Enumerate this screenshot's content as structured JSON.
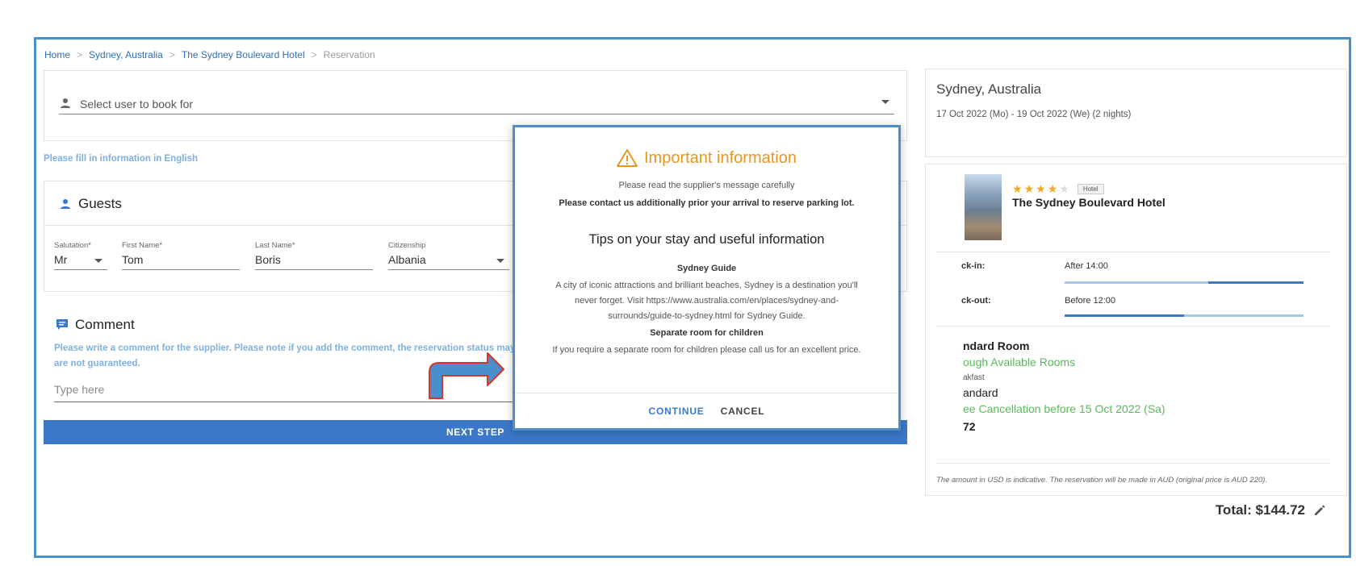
{
  "breadcrumb": [
    {
      "label": "Home"
    },
    {
      "label": "Sydney, Australia"
    },
    {
      "label": "The Sydney Boulevard Hotel"
    },
    {
      "label": "Reservation"
    }
  ],
  "breadcrumb_separator": ">",
  "user_select": {
    "placeholder": "Select user to book for"
  },
  "fill_note": "Please fill in information in English",
  "guests": {
    "title": "Guests",
    "fields": {
      "salutation": {
        "label": "Salutation*",
        "value": "Mr"
      },
      "first_name": {
        "label": "First Name*",
        "value": "Tom"
      },
      "last_name": {
        "label": "Last Name*",
        "value": "Boris"
      },
      "citizenship": {
        "label": "Citizenship",
        "value": "Albania"
      }
    }
  },
  "comment": {
    "title": "Comment",
    "note": "Please write a comment for the supplier. Please note if you add the comment, the reservation status may be cha",
    "note_line2": "are not guaranteed.",
    "placeholder": "Type here"
  },
  "next_step_label": "NEXT STEP",
  "summary": {
    "city": "Sydney, Australia",
    "dates": "17 Oct 2022 (Mo) - 19 Oct 2022 (We) (2 nights)"
  },
  "hotel": {
    "rating": 4,
    "max_rating": 5,
    "badge": "Hotel",
    "name": "The Sydney Boulevard Hotel",
    "checkin_label": "ck-in:",
    "checkin_value": "After 14:00",
    "checkin_level": 0.6,
    "checkout_label": "ck-out:",
    "checkout_value": "Before 12:00",
    "checkout_level": 0.5,
    "room_name": "ndard Room",
    "room_source": "ough Available Rooms",
    "meal": "akfast",
    "room_type": "andard",
    "cancellation": "ee Cancellation before 15 Oct 2022 (Sa)",
    "price": "72",
    "disclaimer": "The amount in USD is indicative. The reservation will be made in AUD (original price is AUD 220)."
  },
  "total": "Total: $144.72",
  "modal": {
    "title": "Important information",
    "subtitle": "Please read the supplier's message carefully",
    "notice": "Please contact us additionally prior your arrival to reserve parking lot.",
    "tips_title": "Tips on your stay and useful information",
    "guide_title": "Sydney Guide",
    "guide_text": "A city of iconic attractions and brilliant beaches, Sydney is a destination you'll never forget. Visit https://www.australia.com/en/places/sydney-and-surrounds/guide-to-sydney.html for Sydney Guide.",
    "children_title": "Separate room for children",
    "children_text": "If you require a separate room for children please call us for an excellent price.",
    "continue_label": "CONTINUE",
    "cancel_label": "CANCEL"
  },
  "colors": {
    "accent": "#3c78c8",
    "warning": "#e8961e",
    "success": "#5cb85c",
    "frame": "#4a8fcb",
    "annotation_arrow": "#d9342b"
  }
}
